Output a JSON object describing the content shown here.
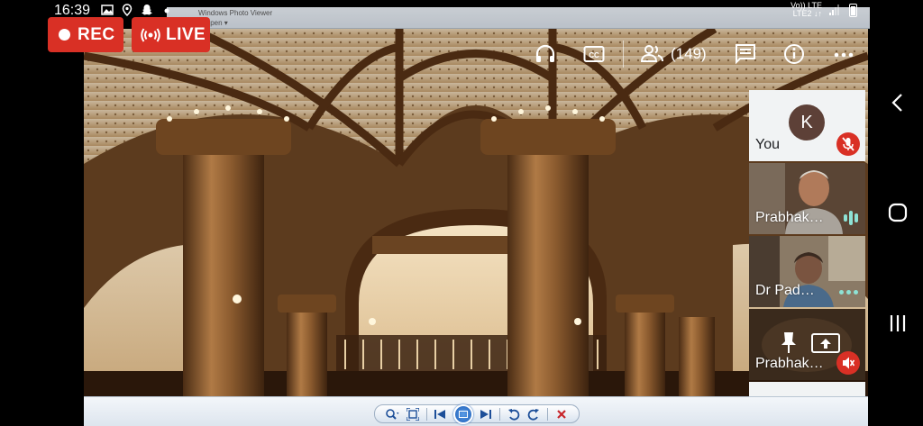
{
  "status_bar": {
    "time": "16:39",
    "network_top": "Vo)) LTE",
    "network_bottom": "LTE2 ↓↑",
    "icons": [
      "image-icon",
      "location-icon",
      "snapchat-icon",
      "dot-icon",
      "signal-icon",
      "battery-icon"
    ]
  },
  "viewer_window": {
    "title": "Windows Photo Viewer",
    "menu": "Open ▾",
    "toolbar_icons": [
      "zoom-icon",
      "fit-icon",
      "previous-icon",
      "slideshow-icon",
      "next-icon",
      "rotate-left-icon",
      "rotate-right-icon",
      "delete-icon"
    ]
  },
  "badges": {
    "rec_label": "REC",
    "live_label": "LIVE"
  },
  "meet_controls": {
    "participants_count": "(149)",
    "icons": [
      "headphones-icon",
      "captions-icon",
      "people-icon",
      "chat-icon",
      "info-icon",
      "more-icon"
    ]
  },
  "participants": [
    {
      "name": "You",
      "avatar_letter": "K",
      "status": "muted"
    },
    {
      "name": "Prabhak…",
      "status": "speaking"
    },
    {
      "name": "Dr Pad…",
      "status": "more"
    },
    {
      "name": "Prabhak…",
      "status": "muted"
    },
    {
      "name": "",
      "status": ""
    }
  ],
  "colors": {
    "accent_red": "#d93025",
    "speaking_teal": "#8ee2d5",
    "avatar_brown": "#5d4037"
  },
  "android_nav": {
    "icons": [
      "back-icon",
      "home-icon",
      "recents-icon"
    ]
  }
}
